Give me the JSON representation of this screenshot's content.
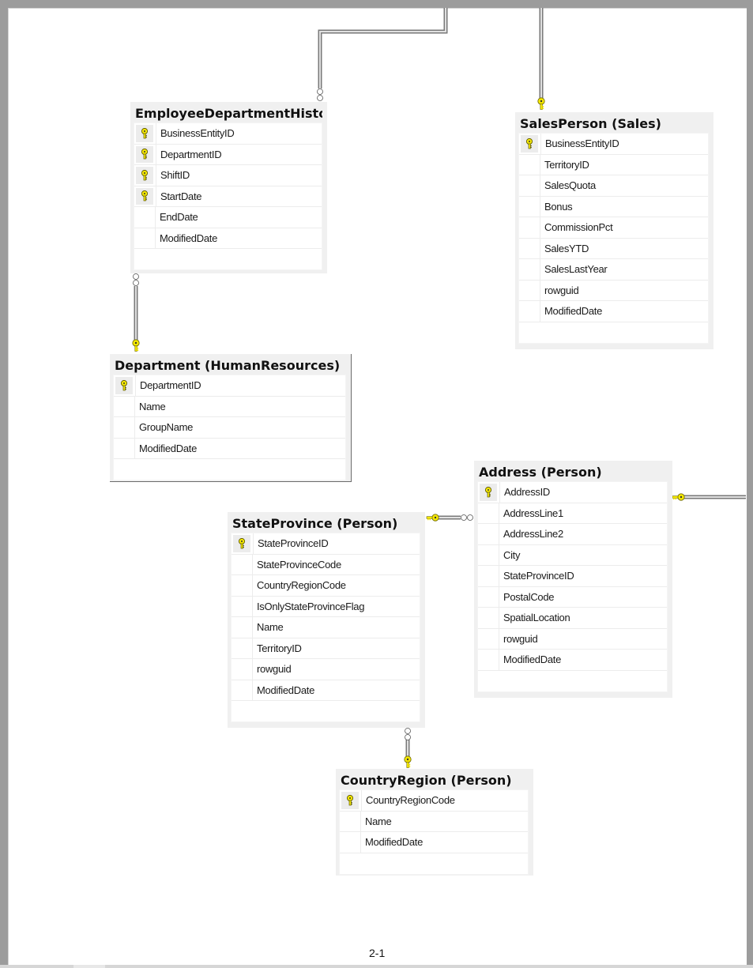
{
  "diagram": {
    "page_number": "2-1",
    "colors": {
      "key": "#f5e800",
      "line": "#a0a0a0",
      "header_bg": "#f0f0f0",
      "frame": "#9c9c9c"
    },
    "tables": [
      {
        "id": "employee-department-history",
        "title": "EmployeeDepartmentHistor",
        "columns": [
          {
            "name": "BusinessEntityID",
            "pk": true
          },
          {
            "name": "DepartmentID",
            "pk": true
          },
          {
            "name": "ShiftID",
            "pk": true
          },
          {
            "name": "StartDate",
            "pk": true
          },
          {
            "name": "EndDate",
            "pk": false
          },
          {
            "name": "ModifiedDate",
            "pk": false
          }
        ]
      },
      {
        "id": "sales-person",
        "title": "SalesPerson (Sales)",
        "columns": [
          {
            "name": "BusinessEntityID",
            "pk": true
          },
          {
            "name": "TerritoryID",
            "pk": false
          },
          {
            "name": "SalesQuota",
            "pk": false
          },
          {
            "name": "Bonus",
            "pk": false
          },
          {
            "name": "CommissionPct",
            "pk": false
          },
          {
            "name": "SalesYTD",
            "pk": false
          },
          {
            "name": "SalesLastYear",
            "pk": false
          },
          {
            "name": "rowguid",
            "pk": false
          },
          {
            "name": "ModifiedDate",
            "pk": false
          }
        ]
      },
      {
        "id": "department",
        "title": "Department (HumanResources)",
        "columns": [
          {
            "name": "DepartmentID",
            "pk": true
          },
          {
            "name": "Name",
            "pk": false
          },
          {
            "name": "GroupName",
            "pk": false
          },
          {
            "name": "ModifiedDate",
            "pk": false
          }
        ]
      },
      {
        "id": "address",
        "title": "Address (Person)",
        "columns": [
          {
            "name": "AddressID",
            "pk": true
          },
          {
            "name": "AddressLine1",
            "pk": false
          },
          {
            "name": "AddressLine2",
            "pk": false
          },
          {
            "name": "City",
            "pk": false
          },
          {
            "name": "StateProvinceID",
            "pk": false
          },
          {
            "name": "PostalCode",
            "pk": false
          },
          {
            "name": "SpatialLocation",
            "pk": false
          },
          {
            "name": "rowguid",
            "pk": false
          },
          {
            "name": "ModifiedDate",
            "pk": false
          }
        ]
      },
      {
        "id": "state-province",
        "title": "StateProvince (Person)",
        "columns": [
          {
            "name": "StateProvinceID",
            "pk": true
          },
          {
            "name": "StateProvinceCode",
            "pk": false
          },
          {
            "name": "CountryRegionCode",
            "pk": false
          },
          {
            "name": "IsOnlyStateProvinceFlag",
            "pk": false
          },
          {
            "name": "Name",
            "pk": false
          },
          {
            "name": "TerritoryID",
            "pk": false
          },
          {
            "name": "rowguid",
            "pk": false
          },
          {
            "name": "ModifiedDate",
            "pk": false
          }
        ]
      },
      {
        "id": "country-region",
        "title": "CountryRegion (Person)",
        "columns": [
          {
            "name": "CountryRegionCode",
            "pk": true
          },
          {
            "name": "Name",
            "pk": false
          },
          {
            "name": "ModifiedDate",
            "pk": false
          }
        ]
      }
    ],
    "relationships": [
      {
        "from": "employee-department-history",
        "to": "(off-page above)",
        "from_end": "many",
        "to_end": "one"
      },
      {
        "from": "sales-person",
        "to": "(off-page above)",
        "from_end": "one",
        "to_end": "one"
      },
      {
        "from": "employee-department-history",
        "to": "department",
        "from_end": "many",
        "to_end": "one"
      },
      {
        "from": "address",
        "to": "state-province",
        "from_end": "many",
        "to_end": "one"
      },
      {
        "from": "address",
        "to": "(off-page right)",
        "from_end": "one",
        "to_end": "many"
      },
      {
        "from": "state-province",
        "to": "country-region",
        "from_end": "many",
        "to_end": "one"
      }
    ]
  }
}
